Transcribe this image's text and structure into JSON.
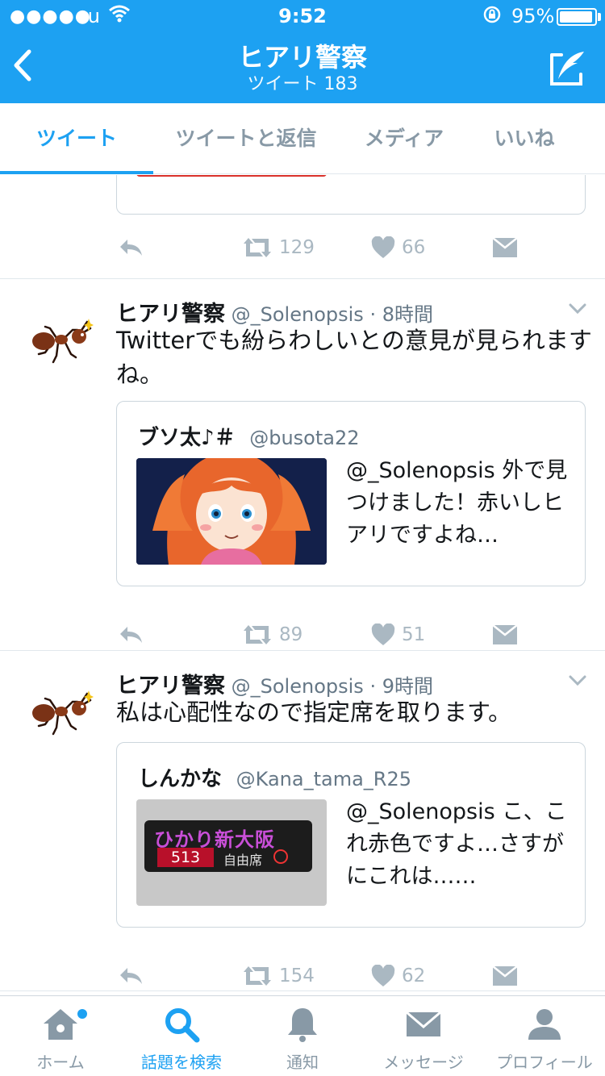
{
  "status": {
    "carrier": "au",
    "time": "9:52",
    "battery": "95%"
  },
  "header": {
    "title": "ヒアリ警察",
    "subtitle": "ツイート 183"
  },
  "profile_tabs": [
    {
      "label": "ツイート"
    },
    {
      "label": "ツイートと返信"
    },
    {
      "label": "メディア"
    },
    {
      "label": "いいね"
    }
  ],
  "partial_tweet": {
    "retweets": "129",
    "likes": "66"
  },
  "tweets": [
    {
      "name": "ヒアリ警察",
      "handle": "@_Solenopsis",
      "time": "· 8時間",
      "text": "Twitterでも紛らわしいとの意見が見られますね。",
      "quote": {
        "name": "ブソ太♪＃",
        "handle": "@busota22",
        "text": "@_Solenopsis 外で見つけました！赤いしヒアリですよね…"
      },
      "retweets": "89",
      "likes": "51"
    },
    {
      "name": "ヒアリ警察",
      "handle": "@_Solenopsis",
      "time": "· 9時間",
      "text": "私は心配性なので指定席を取ります。",
      "quote": {
        "name": "しんかな",
        "handle": "@Kana_tama_R25",
        "text": "@_Solenopsis こ、これ赤色ですよ…さすがにこれは……",
        "image_sign": {
          "destination": "ひかり新大阪",
          "number": "513",
          "car": "自由席"
        }
      },
      "retweets": "154",
      "likes": "62"
    }
  ],
  "tabbar": [
    {
      "label": "ホーム",
      "icon": "home-icon"
    },
    {
      "label": "話題を検索",
      "icon": "search-icon"
    },
    {
      "label": "通知",
      "icon": "bell-icon"
    },
    {
      "label": "メッセージ",
      "icon": "envelope-icon"
    },
    {
      "label": "プロフィール",
      "icon": "person-icon"
    }
  ],
  "colors": {
    "accent": "#1da1f2",
    "muted": "#8899a6",
    "icon_gray": "#aab8c2"
  }
}
